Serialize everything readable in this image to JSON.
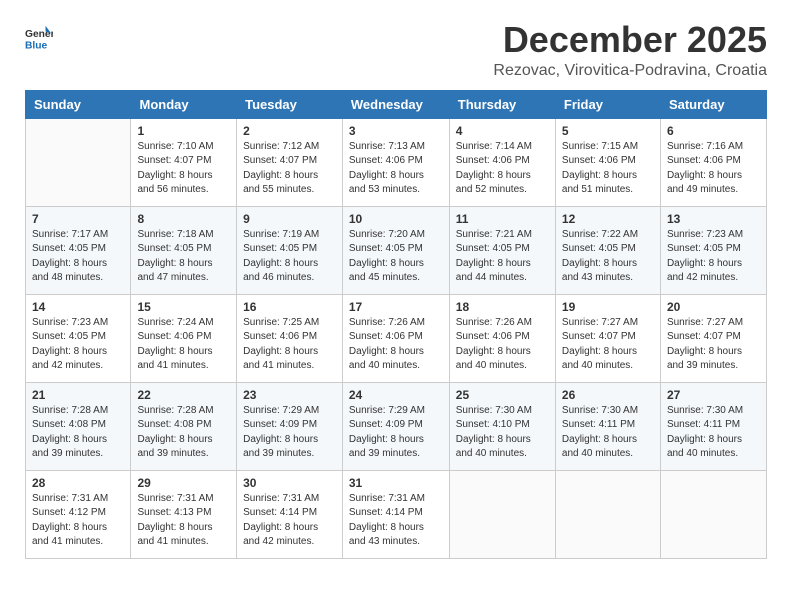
{
  "header": {
    "logo_general": "General",
    "logo_blue": "Blue",
    "month_title": "December 2025",
    "location": "Rezovac, Virovitica-Podravina, Croatia"
  },
  "weekdays": [
    "Sunday",
    "Monday",
    "Tuesday",
    "Wednesday",
    "Thursday",
    "Friday",
    "Saturday"
  ],
  "weeks": [
    [
      {
        "day": "",
        "sunrise": "",
        "sunset": "",
        "daylight": ""
      },
      {
        "day": "1",
        "sunrise": "7:10 AM",
        "sunset": "4:07 PM",
        "daylight": "8 hours and 56 minutes."
      },
      {
        "day": "2",
        "sunrise": "7:12 AM",
        "sunset": "4:07 PM",
        "daylight": "8 hours and 55 minutes."
      },
      {
        "day": "3",
        "sunrise": "7:13 AM",
        "sunset": "4:06 PM",
        "daylight": "8 hours and 53 minutes."
      },
      {
        "day": "4",
        "sunrise": "7:14 AM",
        "sunset": "4:06 PM",
        "daylight": "8 hours and 52 minutes."
      },
      {
        "day": "5",
        "sunrise": "7:15 AM",
        "sunset": "4:06 PM",
        "daylight": "8 hours and 51 minutes."
      },
      {
        "day": "6",
        "sunrise": "7:16 AM",
        "sunset": "4:06 PM",
        "daylight": "8 hours and 49 minutes."
      }
    ],
    [
      {
        "day": "7",
        "sunrise": "7:17 AM",
        "sunset": "4:05 PM",
        "daylight": "8 hours and 48 minutes."
      },
      {
        "day": "8",
        "sunrise": "7:18 AM",
        "sunset": "4:05 PM",
        "daylight": "8 hours and 47 minutes."
      },
      {
        "day": "9",
        "sunrise": "7:19 AM",
        "sunset": "4:05 PM",
        "daylight": "8 hours and 46 minutes."
      },
      {
        "day": "10",
        "sunrise": "7:20 AM",
        "sunset": "4:05 PM",
        "daylight": "8 hours and 45 minutes."
      },
      {
        "day": "11",
        "sunrise": "7:21 AM",
        "sunset": "4:05 PM",
        "daylight": "8 hours and 44 minutes."
      },
      {
        "day": "12",
        "sunrise": "7:22 AM",
        "sunset": "4:05 PM",
        "daylight": "8 hours and 43 minutes."
      },
      {
        "day": "13",
        "sunrise": "7:23 AM",
        "sunset": "4:05 PM",
        "daylight": "8 hours and 42 minutes."
      }
    ],
    [
      {
        "day": "14",
        "sunrise": "7:23 AM",
        "sunset": "4:05 PM",
        "daylight": "8 hours and 42 minutes."
      },
      {
        "day": "15",
        "sunrise": "7:24 AM",
        "sunset": "4:06 PM",
        "daylight": "8 hours and 41 minutes."
      },
      {
        "day": "16",
        "sunrise": "7:25 AM",
        "sunset": "4:06 PM",
        "daylight": "8 hours and 41 minutes."
      },
      {
        "day": "17",
        "sunrise": "7:26 AM",
        "sunset": "4:06 PM",
        "daylight": "8 hours and 40 minutes."
      },
      {
        "day": "18",
        "sunrise": "7:26 AM",
        "sunset": "4:06 PM",
        "daylight": "8 hours and 40 minutes."
      },
      {
        "day": "19",
        "sunrise": "7:27 AM",
        "sunset": "4:07 PM",
        "daylight": "8 hours and 40 minutes."
      },
      {
        "day": "20",
        "sunrise": "7:27 AM",
        "sunset": "4:07 PM",
        "daylight": "8 hours and 39 minutes."
      }
    ],
    [
      {
        "day": "21",
        "sunrise": "7:28 AM",
        "sunset": "4:08 PM",
        "daylight": "8 hours and 39 minutes."
      },
      {
        "day": "22",
        "sunrise": "7:28 AM",
        "sunset": "4:08 PM",
        "daylight": "8 hours and 39 minutes."
      },
      {
        "day": "23",
        "sunrise": "7:29 AM",
        "sunset": "4:09 PM",
        "daylight": "8 hours and 39 minutes."
      },
      {
        "day": "24",
        "sunrise": "7:29 AM",
        "sunset": "4:09 PM",
        "daylight": "8 hours and 39 minutes."
      },
      {
        "day": "25",
        "sunrise": "7:30 AM",
        "sunset": "4:10 PM",
        "daylight": "8 hours and 40 minutes."
      },
      {
        "day": "26",
        "sunrise": "7:30 AM",
        "sunset": "4:11 PM",
        "daylight": "8 hours and 40 minutes."
      },
      {
        "day": "27",
        "sunrise": "7:30 AM",
        "sunset": "4:11 PM",
        "daylight": "8 hours and 40 minutes."
      }
    ],
    [
      {
        "day": "28",
        "sunrise": "7:31 AM",
        "sunset": "4:12 PM",
        "daylight": "8 hours and 41 minutes."
      },
      {
        "day": "29",
        "sunrise": "7:31 AM",
        "sunset": "4:13 PM",
        "daylight": "8 hours and 41 minutes."
      },
      {
        "day": "30",
        "sunrise": "7:31 AM",
        "sunset": "4:14 PM",
        "daylight": "8 hours and 42 minutes."
      },
      {
        "day": "31",
        "sunrise": "7:31 AM",
        "sunset": "4:14 PM",
        "daylight": "8 hours and 43 minutes."
      },
      {
        "day": "",
        "sunrise": "",
        "sunset": "",
        "daylight": ""
      },
      {
        "day": "",
        "sunrise": "",
        "sunset": "",
        "daylight": ""
      },
      {
        "day": "",
        "sunrise": "",
        "sunset": "",
        "daylight": ""
      }
    ]
  ]
}
